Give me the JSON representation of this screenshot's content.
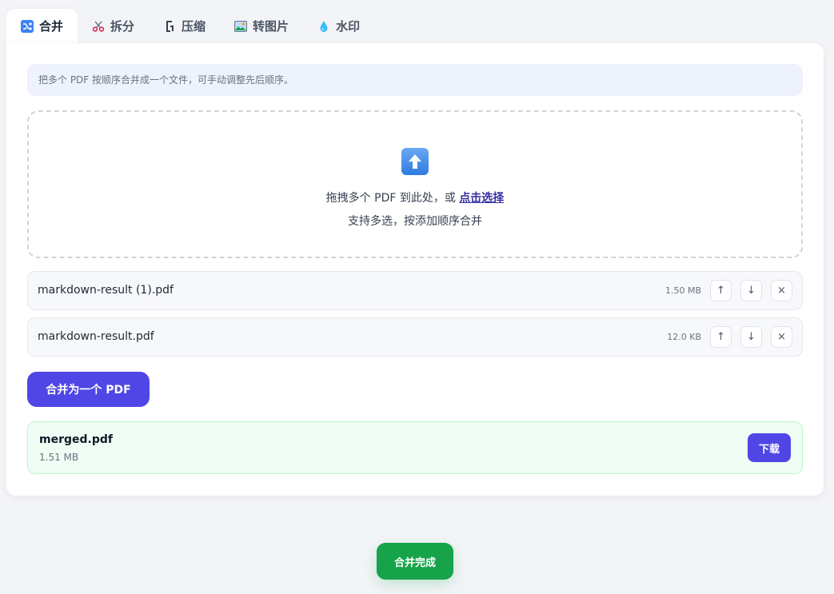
{
  "tabs": [
    {
      "label": "合并",
      "icon": "shuffle-icon",
      "active": true
    },
    {
      "label": "拆分",
      "icon": "scissors-icon",
      "active": false
    },
    {
      "label": "压缩",
      "icon": "clamp-icon",
      "active": false
    },
    {
      "label": "转图片",
      "icon": "image-icon",
      "active": false
    },
    {
      "label": "水印",
      "icon": "droplet-icon",
      "active": false
    }
  ],
  "info_text": "把多个 PDF 按顺序合并成一个文件，可手动调整先后顺序。",
  "dropzone": {
    "icon": "upload-arrow-icon",
    "line1_prefix": "拖拽多个 PDF 到此处，或 ",
    "link_text": "点击选择",
    "line2": "支持多选，按添加顺序合并"
  },
  "files": [
    {
      "name": "markdown-result (1).pdf",
      "size": "1.50 MB"
    },
    {
      "name": "markdown-result.pdf",
      "size": "12.0 KB"
    }
  ],
  "file_actions": {
    "up": "↑",
    "down": "↓",
    "remove": "×"
  },
  "merge_button": "合并为一个 PDF",
  "result": {
    "name": "merged.pdf",
    "size": "1.51 MB",
    "download_label": "下载"
  },
  "toast": "合并完成",
  "colors": {
    "primary": "#4f46e5",
    "success": "#16a34a",
    "info_bg": "#eef2fd",
    "result_bg": "#f0fdf4"
  }
}
